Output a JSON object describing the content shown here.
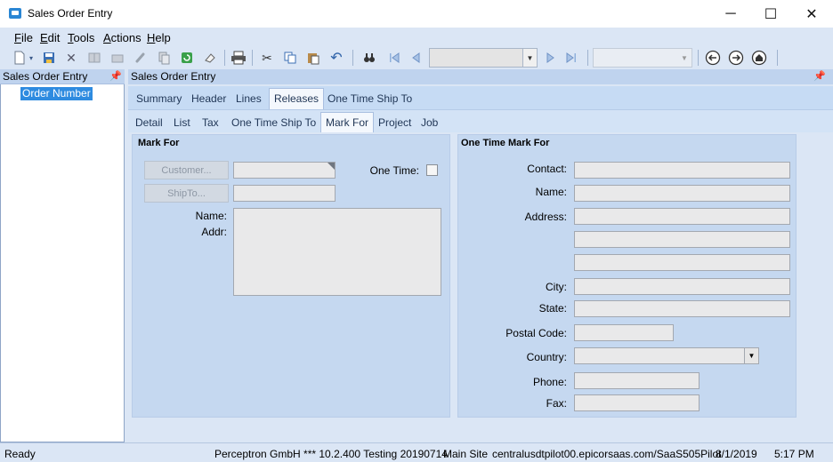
{
  "window": {
    "title": "Sales Order Entry",
    "controls": {
      "minimize": "─",
      "maximize": "☐",
      "close": "✕"
    }
  },
  "menu": [
    {
      "label": "File",
      "accel": "F",
      "rest": "ile"
    },
    {
      "label": "Edit",
      "accel": "E",
      "rest": "dit"
    },
    {
      "label": "Tools",
      "accel": "T",
      "rest": "ools"
    },
    {
      "label": "Actions",
      "accel": "A",
      "rest": "ctions"
    },
    {
      "label": "Help",
      "accel": "H",
      "rest": "elp"
    }
  ],
  "toolbar": {
    "icons": [
      "new-icon",
      "save-icon",
      "delete-icon",
      "book-icon",
      "folder-icon",
      "attach-icon",
      "copy-doc-icon",
      "refresh-icon",
      "clear-icon",
      "print-icon",
      "cut-icon",
      "copy-icon",
      "paste-icon",
      "undo-icon",
      "find-icon",
      "first-icon",
      "previous-icon",
      "next-icon",
      "last-icon",
      "back-icon",
      "forward-icon",
      "home-icon"
    ],
    "navigation_combo_value": "",
    "secondary_combo_value": ""
  },
  "left_panel": {
    "header": "Sales Order Entry",
    "tree_node": "Order Number"
  },
  "content": {
    "header": "Sales Order Entry",
    "tabs_level1": [
      "Summary",
      "Header",
      "Lines",
      "Releases",
      "One Time Ship To"
    ],
    "active_tab_level1": "Releases",
    "tabs_level2": [
      "Detail",
      "List",
      "Tax",
      "One Time Ship To",
      "Mark For",
      "Project",
      "Job"
    ],
    "active_tab_level2": "Mark For"
  },
  "mark_for": {
    "title": "Mark For",
    "customer_button": "Customer...",
    "customer_value": "",
    "shipto_button": "ShipTo...",
    "shipto_value": "",
    "one_time_label": "One Time:",
    "one_time_checked": false,
    "name_label": "Name:",
    "addr_label": "Addr:",
    "address_value": ""
  },
  "one_time_mark_for": {
    "title": "One Time Mark For",
    "contact_label": "Contact:",
    "name_label": "Name:",
    "address_label": "Address:",
    "city_label": "City:",
    "state_label": "State:",
    "postal_label": "Postal Code:",
    "country_label": "Country:",
    "phone_label": "Phone:",
    "fax_label": "Fax:"
  },
  "status_bar": {
    "state": "Ready",
    "company": "Perceptron GmbH *** 10.2.400 Testing 20190714",
    "site": "Main Site",
    "server": "centralusdtpilot00.epicorsaas.com/SaaS505Pilot",
    "date": "8/1/2019",
    "time": "5:17 PM"
  }
}
